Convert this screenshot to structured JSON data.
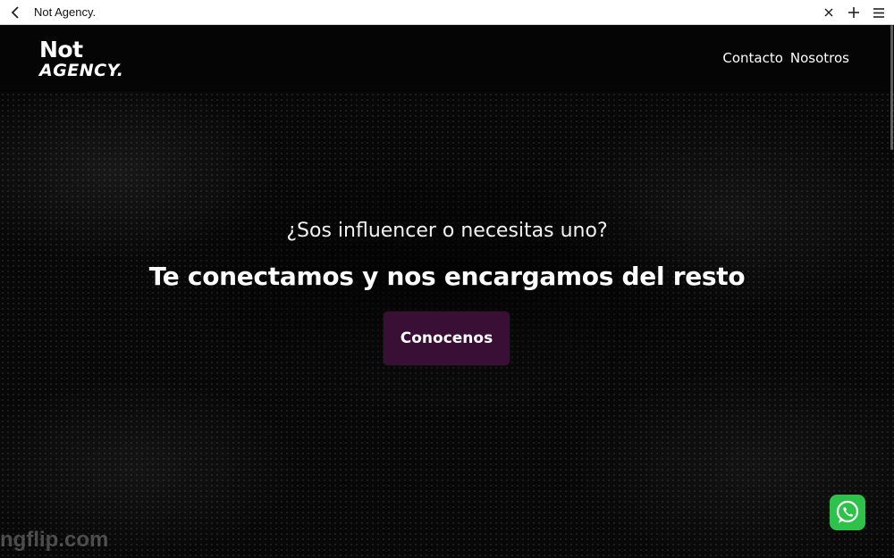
{
  "browser": {
    "title": "Not Agency.",
    "back_icon": "chevron-left-icon",
    "actions": [
      "close-icon",
      "plus-icon",
      "menu-icon"
    ]
  },
  "header": {
    "logo_line1": "Not",
    "logo_line2": "AGENCY.",
    "nav": [
      {
        "label": "Contacto"
      },
      {
        "label": "Nosotros"
      }
    ]
  },
  "hero": {
    "subtitle": "¿Sos influencer o necesitas uno?",
    "headline": "Te conectamos y nos encargamos del resto",
    "cta_label": "Conocenos",
    "cta_color": "#3a0f35"
  },
  "watermark": "ngflip.com",
  "whatsapp": {
    "icon": "whatsapp-icon",
    "color": "#2fc24b"
  }
}
